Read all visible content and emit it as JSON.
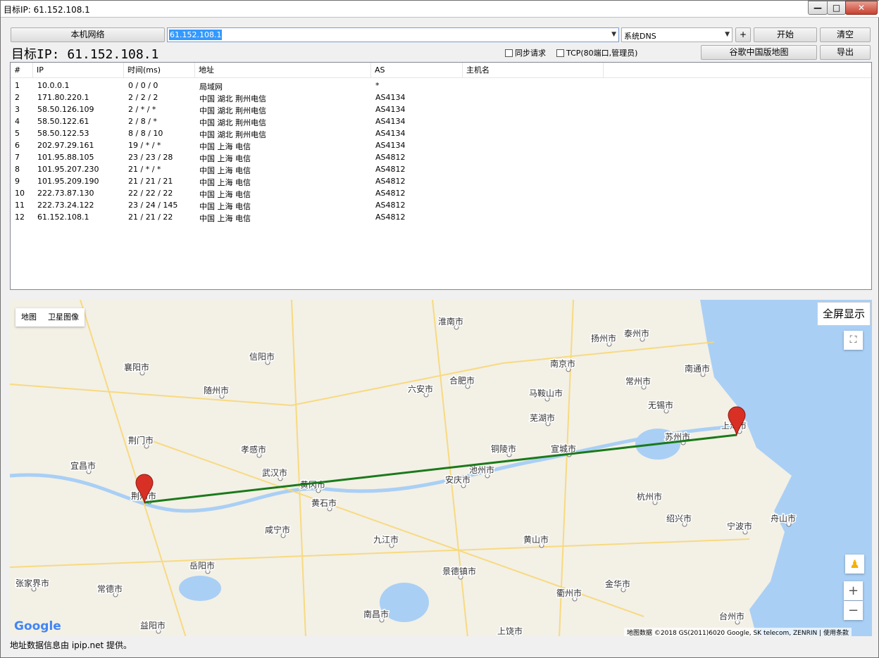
{
  "window": {
    "title": "目标IP: 61.152.108.1",
    "min": "—",
    "max": "□",
    "close": "✕"
  },
  "toolbar": {
    "local_network": "本机网络",
    "ip_value": "61.152.108.1",
    "dns_value": "系统DNS",
    "plus": "+",
    "start": "开始",
    "clear": "清空",
    "google_china_map": "谷歌中国版地图",
    "export": "导出",
    "sync_request": "同步请求",
    "tcp_option": "TCP(80端口,管理员)"
  },
  "target_label": "目标IP:  61.152.108.1",
  "table": {
    "headers": [
      "#",
      "IP",
      "时间(ms)",
      "地址",
      "AS",
      "主机名"
    ],
    "rows": [
      [
        "1",
        "10.0.0.1",
        "0 / 0 / 0",
        "局域网",
        "*"
      ],
      [
        "2",
        "171.80.220.1",
        "2 / 2 / 2",
        "中国 湖北 荆州电信",
        "AS4134"
      ],
      [
        "3",
        "58.50.126.109",
        "2 / * / *",
        "中国 湖北 荆州电信",
        "AS4134"
      ],
      [
        "4",
        "58.50.122.61",
        "2 / 8 / *",
        "中国 湖北 荆州电信",
        "AS4134"
      ],
      [
        "5",
        "58.50.122.53",
        "8 / 8 / 10",
        "中国 湖北 荆州电信",
        "AS4134"
      ],
      [
        "6",
        "202.97.29.161",
        "19 / * / *",
        "中国 上海 电信",
        "AS4134"
      ],
      [
        "7",
        "101.95.88.105",
        "23 / 23 / 28",
        "中国 上海 电信",
        "AS4812"
      ],
      [
        "8",
        "101.95.207.230",
        "21 / * / *",
        "中国 上海 电信",
        "AS4812"
      ],
      [
        "9",
        "101.95.209.190",
        "21 / 21 / 21",
        "中国 上海 电信",
        "AS4812"
      ],
      [
        "10",
        "222.73.87.130",
        "22 / 22 / 22",
        "中国 上海 电信",
        "AS4812"
      ],
      [
        "11",
        "222.73.24.122",
        "23 / 24 / 145",
        "中国 上海 电信",
        "AS4812"
      ],
      [
        "12",
        "61.152.108.1",
        "21 / 21 / 22",
        "中国 上海 电信",
        "AS4812"
      ]
    ]
  },
  "map": {
    "type_map": "地图",
    "type_satellite": "卫星图像",
    "fullscreen": "全屏显示",
    "fs_icon": "⛶",
    "pegman": "♟",
    "zoom_in": "+",
    "zoom_out": "−",
    "google": "Google",
    "copyright": "地图数据 ©2018 GS(2011)6020 Google, SK telecom, ZENRIN  |  使用条款",
    "cities": [
      "襄阳市",
      "信阳市",
      "随州市",
      "荆门市",
      "孝感市",
      "宜昌市",
      "武汉市",
      "黄冈市",
      "荆州市",
      "黄石市",
      "咸宁市",
      "岳阳市",
      "常德市",
      "张家界市",
      "益阳市",
      "九江市",
      "南昌市",
      "安庆市",
      "池州市",
      "合肥市",
      "六安市",
      "淮南市",
      "南京市",
      "马鞍山市",
      "芜湖市",
      "铜陵市",
      "宣城市",
      "扬州市",
      "泰州市",
      "常州市",
      "无锡市",
      "苏州市",
      "南通市",
      "上海市",
      "杭州市",
      "绍兴市",
      "宁波市",
      "舟山市",
      "黄山市",
      "景德镇市",
      "衢州市",
      "金华市",
      "台州市",
      "上饶市"
    ],
    "route_color": "#1a7a1a",
    "marker_color": "#d93025"
  },
  "status": "地址数据信息由 ipip.net 提供。"
}
